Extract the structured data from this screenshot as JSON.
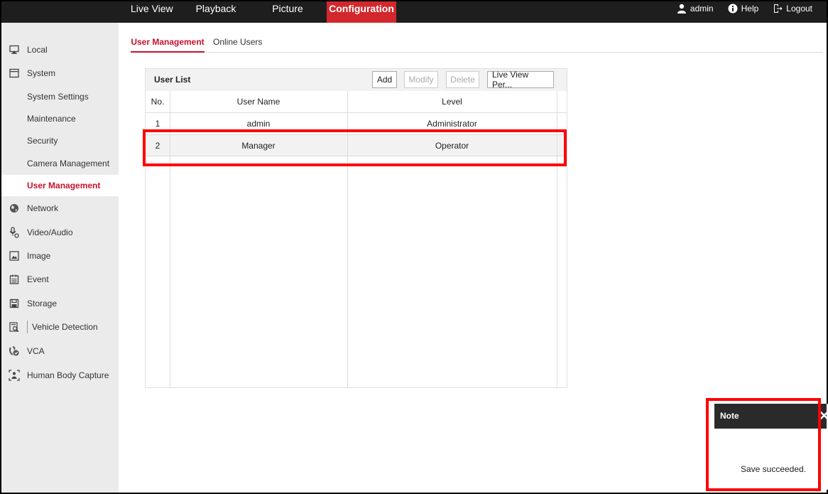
{
  "topnav": {
    "live_view": "Live View",
    "playback": "Playback",
    "picture": "Picture",
    "configuration": "Configuration"
  },
  "topright": {
    "user": "admin",
    "help": "Help",
    "logout": "Logout"
  },
  "sidebar": {
    "local": "Local",
    "system": "System",
    "system_settings": "System Settings",
    "maintenance": "Maintenance",
    "security": "Security",
    "camera_management": "Camera Management",
    "user_management": "User Management",
    "network": "Network",
    "video_audio": "Video/Audio",
    "image": "Image",
    "event": "Event",
    "storage": "Storage",
    "vehicle_detection": "Vehicle Detection",
    "vca": "VCA",
    "human_body_capture": "Human Body Capture"
  },
  "tabs": {
    "user_management": "User Management",
    "online_users": "Online Users"
  },
  "user_list": {
    "title": "User List",
    "buttons": {
      "add": "Add",
      "modify": "Modify",
      "delete": "Delete",
      "live_view_permission": "Live View Per..."
    },
    "columns": {
      "no": "No.",
      "user_name": "User Name",
      "level": "Level"
    },
    "rows": [
      {
        "no": "1",
        "user_name": "admin",
        "level": "Administrator"
      },
      {
        "no": "2",
        "user_name": "Manager",
        "level": "Operator"
      }
    ]
  },
  "note": {
    "title": "Note",
    "close": "✕",
    "message": "Save succeeded."
  },
  "colors": {
    "accent": "#c8102e",
    "nav_active": "#d2282d",
    "topbar": "#1e1e1e",
    "annotation": "#ff0000"
  }
}
